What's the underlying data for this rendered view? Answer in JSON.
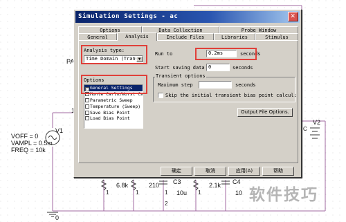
{
  "schematic": {
    "net_label_pa": "PA",
    "net_1": "1",
    "v1_label": "V1",
    "v1_params": [
      "VOFF = 0",
      "VAMPL = 0.5m",
      "FREQ = 10k"
    ],
    "v2_label": "V2",
    "c_label_right": "C",
    "r1_value": "6.8k",
    "r2_value": "210",
    "c3_label": "C3",
    "c3_value": "10u",
    "r3_value": "2.1k",
    "c4_label": "C4",
    "c4_value": "10",
    "pin_1": "1",
    "pin_2": "2",
    "ground": "0"
  },
  "dialog": {
    "title": "Simulation Settings - ac",
    "close_glyph": "✕",
    "tabs_row1": [
      "Options",
      "Data Collection",
      "Probe Window"
    ],
    "tabs_row2": [
      "General",
      "Analysis",
      "Include Files",
      "Libraries",
      "Stimulus"
    ],
    "active_tab": "Analysis",
    "analysis_type_label": "Analysis type:",
    "analysis_type_value": "Time Domain (Transi",
    "options_label": "Options",
    "options": [
      {
        "label": "General Settings",
        "checked": true,
        "selected": true
      },
      {
        "label": "Monte Carlo/Worst Cas",
        "checked": false,
        "selected": false
      },
      {
        "label": "Parametric Sweep",
        "checked": false,
        "selected": false
      },
      {
        "label": "Temperature (Sweep)",
        "checked": false,
        "selected": false
      },
      {
        "label": "Save Bias Point",
        "checked": false,
        "selected": false
      },
      {
        "label": "Load Bias Point",
        "checked": false,
        "selected": false
      }
    ],
    "run_to_label": "Run to",
    "run_to_value": "0.2ms",
    "run_to_unit": "seconds",
    "start_saving_label": "Start saving data",
    "start_saving_value": "0",
    "start_saving_unit": "seconds",
    "transient_label": "Transient options",
    "max_step_label": "Maximum step",
    "max_step_value": "",
    "max_step_unit": "seconds",
    "skip_bias_label": "Skip the initial transient bias point calcul:",
    "output_file_button": "Output File Options.",
    "ok_button": "确定",
    "cancel_button": "取消",
    "apply_button": "应用(A)",
    "help_button": "帮助",
    "highlight_color": "#e0403a"
  },
  "watermark": "软件技巧"
}
